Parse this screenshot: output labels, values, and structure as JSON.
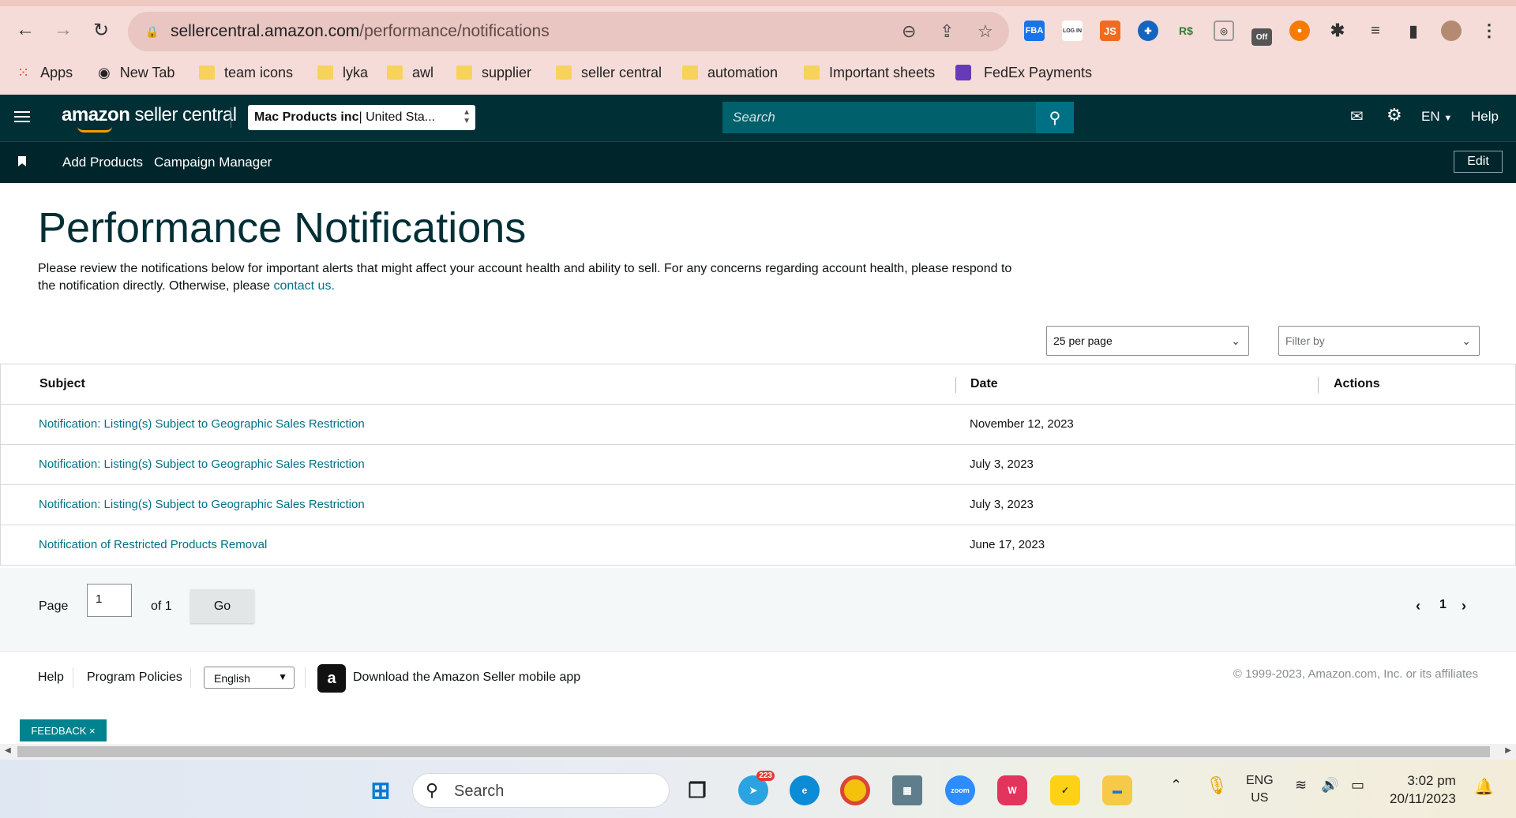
{
  "browser": {
    "url_host": "sellercentral.amazon.com",
    "url_path": "/performance/notifications",
    "bookmarks": [
      "Apps",
      "New Tab",
      "team icons",
      "lyka",
      "awl",
      "supplier",
      "seller central",
      "automation",
      "Important sheets",
      "FedEx Payments"
    ],
    "extensions": [
      "FBA",
      "LOG IN",
      "JS",
      "Off"
    ]
  },
  "header": {
    "logo_main": "amazon",
    "logo_sub": "seller central",
    "store_name": "Mac Products inc",
    "store_region": " | United Sta...",
    "search_placeholder": "Search",
    "lang": "EN",
    "help": "Help",
    "sub_links": [
      "Add Products",
      "Campaign Manager"
    ],
    "edit": "Edit"
  },
  "page": {
    "title": "Performance Notifications",
    "desc": "Please review the notifications below for important alerts that might affect your account health and ability to sell. For any concerns regarding account health, please respond to the notification directly. Otherwise, please ",
    "contact": "contact us.",
    "per_page": "25 per page",
    "filter_placeholder": "Filter by"
  },
  "table": {
    "columns": [
      "Subject",
      "Date",
      "Actions"
    ],
    "rows": [
      {
        "subject": "Notification: Listing(s) Subject to Geographic Sales Restriction",
        "date": "November 12, 2023"
      },
      {
        "subject": "Notification: Listing(s) Subject to Geographic Sales Restriction",
        "date": "July 3, 2023"
      },
      {
        "subject": "Notification: Listing(s) Subject to Geographic Sales Restriction",
        "date": "July 3, 2023"
      },
      {
        "subject": "Notification of Restricted Products Removal",
        "date": "June 17, 2023"
      }
    ]
  },
  "pager": {
    "page_label": "Page",
    "page_value": "1",
    "of_label": "of 1",
    "go": "Go",
    "current": "1"
  },
  "footer": {
    "help": "Help",
    "policies": "Program Policies",
    "language": "English",
    "app_text": "Download the Amazon Seller mobile app",
    "copyright": "© 1999-2023, Amazon.com, Inc. or its affiliates",
    "feedback": "FEEDBACK ×"
  },
  "taskbar": {
    "search": "Search",
    "telegram_badge": "223",
    "lang1": "ENG",
    "lang2": "US",
    "time": "3:02 pm",
    "date": "20/11/2023",
    "zoom": "zoom"
  }
}
